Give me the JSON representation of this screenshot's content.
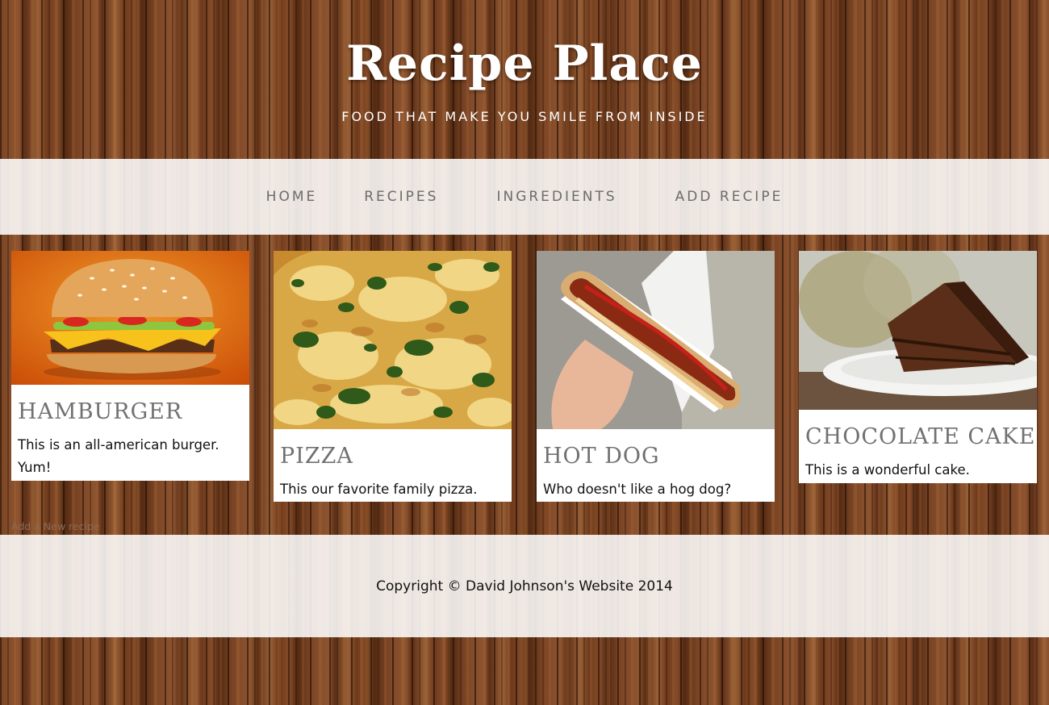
{
  "header": {
    "title": "Recipe Place",
    "tagline": "FOOD THAT MAKE YOU SMILE FROM INSIDE"
  },
  "nav": {
    "items": [
      {
        "label": "HOME"
      },
      {
        "label": "RECIPES"
      },
      {
        "label": "INGREDIENTS"
      },
      {
        "label": "ADD RECIPE"
      }
    ]
  },
  "recipes": [
    {
      "title": "HAMBURGER",
      "description": "This is an all-american burger. Yum!",
      "image_icon": "hamburger-image"
    },
    {
      "title": "PIZZA",
      "description": "This our favorite family pizza.",
      "image_icon": "pizza-image"
    },
    {
      "title": "HOT DOG",
      "description": "Who doesn't like a hog dog?",
      "image_icon": "hot-dog-image"
    },
    {
      "title": "CHOCOLATE CAKE",
      "description": "This is a wonderful cake.",
      "image_icon": "chocolate-cake-image"
    }
  ],
  "add_recipe_link": "Add a New recipe",
  "footer": {
    "copyright": "Copyright © David Johnson's Website 2014"
  },
  "colors": {
    "nav_text": "#6c6c6c",
    "card_title": "#717171",
    "overlay": "#ffffff"
  }
}
